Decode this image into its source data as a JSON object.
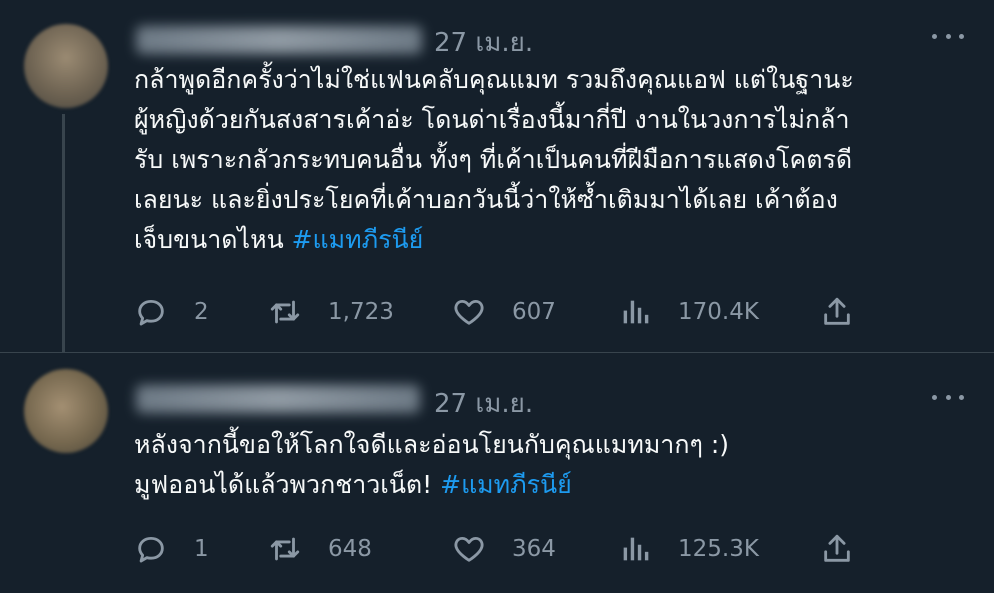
{
  "tweets": [
    {
      "date": "27 เม.ย.",
      "lines": [
        "กล้าพูดอีกครั้งว่าไม่ใช่แฟนคลับคุณแมท รวมถึงคุณแอฟ แต่ในฐานะ",
        "ผู้หญิงด้วยกันสงสารเค้าอ่ะ โดนด่าเรื่องนี้มากี่ปี งานในวงการไม่กล้า",
        "รับ เพราะกลัวกระทบคนอื่น ทั้งๆ ที่เค้าเป็นคนที่ฝีมือการแสดงโคตรดี",
        "เลยนะ และยิ่งประโยคที่เค้าบอกวันนี้ว่าให้ซ้ำเติมมาได้เลย เค้าต้อง",
        "เจ็บขนาดไหน "
      ],
      "hashtag": "#แมทภีรนีย์",
      "replies": "2",
      "retweets": "1,723",
      "likes": "607",
      "views": "170.4K"
    },
    {
      "date": "27 เม.ย.",
      "lines": [
        "หลังจากนี้ขอให้โลกใจดีและอ่อนโยนกับคุณแมทมากๆ :)",
        "มูฟออนได้แล้วพวกชาวเน็ต! "
      ],
      "hashtag": "#แมทภีรนีย์",
      "replies": "1",
      "retweets": "648",
      "likes": "364",
      "views": "125.3K"
    }
  ],
  "colors": {
    "background": "#15202b",
    "text": "#f7f9f9",
    "muted": "#8b98a5",
    "link": "#1d9bf0",
    "divider": "#38444d"
  },
  "icons": [
    "reply-icon",
    "retweet-icon",
    "like-icon",
    "views-icon",
    "share-icon",
    "more-icon"
  ]
}
